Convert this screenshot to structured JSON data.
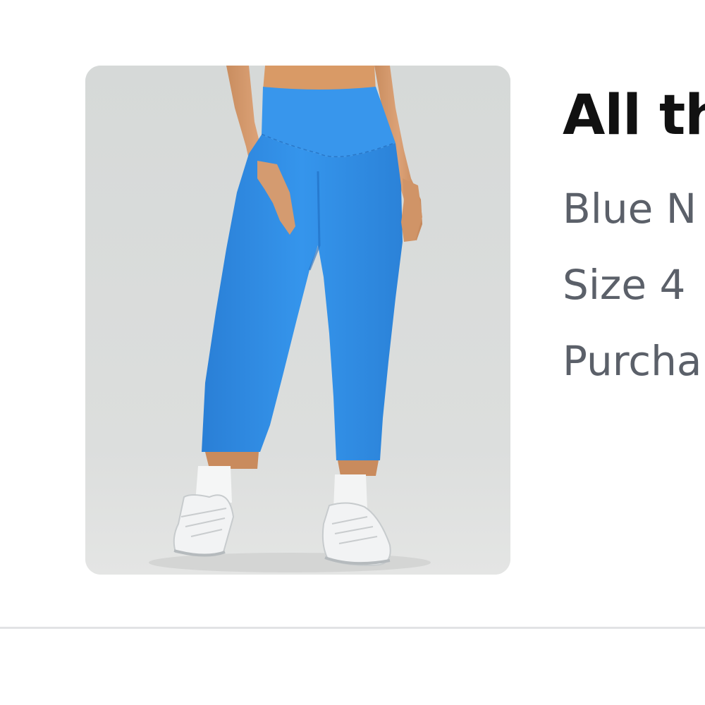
{
  "product": {
    "title": "All th",
    "color_line": "Blue N",
    "size_line": "Size 4",
    "purchase_line": "Purcha",
    "image_subject": "blue high-rise leggings with white socks and white sneakers",
    "leggings_color": "#2f8fe6",
    "background_color": "#d9dcdb"
  }
}
